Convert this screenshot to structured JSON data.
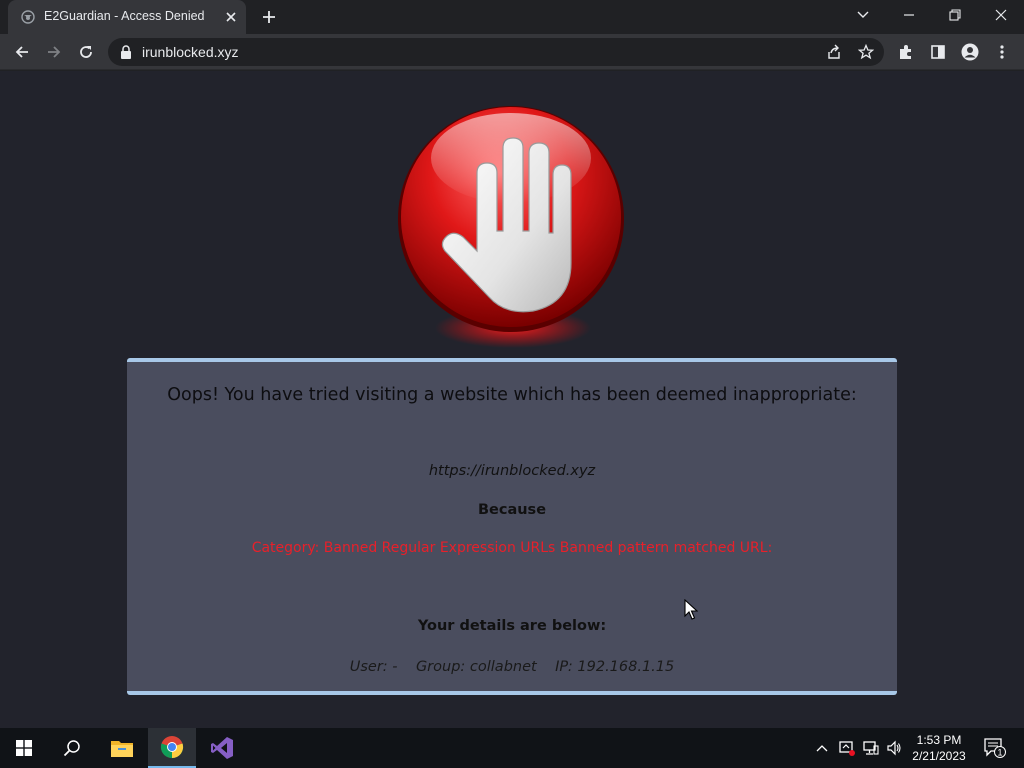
{
  "browser": {
    "tab_title": "E2Guardian - Access Denied",
    "url": "irunblocked.xyz"
  },
  "page": {
    "headline": "Oops! You have tried visiting a website which has been deemed inappropriate:",
    "blocked_url": "https://irunblocked.xyz",
    "because_label": "Because",
    "reason": "Category: Banned Regular Expression URLs   Banned pattern matched URL:",
    "details_heading": "Your details are below:",
    "details": "User: -    Group: collabnet    IP: 192.168.1.15"
  },
  "taskbar": {
    "time": "1:53 PM",
    "date": "2/21/2023",
    "notification_count": "1",
    "pinned_apps": [
      "file-explorer",
      "chrome",
      "visual-studio"
    ]
  },
  "colors": {
    "background": "#22232c",
    "panel": "#4a4d5e",
    "panel_border": "#a8c8e8",
    "reason_text": "#e8202a",
    "accent": "#76b9ed"
  }
}
